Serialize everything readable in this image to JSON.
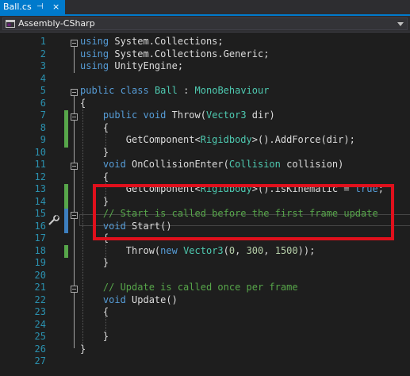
{
  "tab": {
    "title": "Ball.cs",
    "pin_glyph": "⊣",
    "close_glyph": "×"
  },
  "nav": {
    "project": "Assembly-CSharp"
  },
  "colors": {
    "keyword": "#569cd6",
    "type": "#4ec9b0",
    "comment": "#57a64a",
    "number": "#b5cea8",
    "line_number": "#2b91af",
    "highlight_box": "#e0101c",
    "accent": "#007acc"
  },
  "lines": [
    {
      "n": "1",
      "parts": [
        {
          "t": "using",
          "c": "kw"
        },
        {
          "t": " System.Collections;"
        }
      ]
    },
    {
      "n": "2",
      "parts": [
        {
          "t": "using",
          "c": "kw"
        },
        {
          "t": " System.Collections.Generic;"
        }
      ]
    },
    {
      "n": "3",
      "parts": [
        {
          "t": "using",
          "c": "kw"
        },
        {
          "t": " UnityEngine;"
        }
      ]
    },
    {
      "n": "4",
      "parts": []
    },
    {
      "n": "5",
      "parts": [
        {
          "t": "public",
          "c": "kw"
        },
        {
          "t": " "
        },
        {
          "t": "class",
          "c": "kw"
        },
        {
          "t": " "
        },
        {
          "t": "Ball",
          "c": "ty"
        },
        {
          "t": " : "
        },
        {
          "t": "MonoBehaviour",
          "c": "ty"
        }
      ]
    },
    {
      "n": "6",
      "parts": [
        {
          "t": "{"
        }
      ]
    },
    {
      "n": "7",
      "parts": [
        {
          "t": "    "
        },
        {
          "t": "public",
          "c": "kw"
        },
        {
          "t": " "
        },
        {
          "t": "void",
          "c": "kw"
        },
        {
          "t": " Throw("
        },
        {
          "t": "Vector3",
          "c": "ty"
        },
        {
          "t": " dir)"
        }
      ]
    },
    {
      "n": "8",
      "parts": [
        {
          "t": "    {"
        }
      ]
    },
    {
      "n": "9",
      "parts": [
        {
          "t": "        GetComponent<"
        },
        {
          "t": "Rigidbody",
          "c": "ty"
        },
        {
          "t": ">().AddForce(dir);"
        }
      ]
    },
    {
      "n": "10",
      "parts": [
        {
          "t": "    }"
        }
      ]
    },
    {
      "n": "11",
      "parts": [
        {
          "t": "    "
        },
        {
          "t": "void",
          "c": "kw"
        },
        {
          "t": " OnCollisionEnter("
        },
        {
          "t": "Collision",
          "c": "ty"
        },
        {
          "t": " collision)"
        }
      ]
    },
    {
      "n": "12",
      "parts": [
        {
          "t": "    {"
        }
      ]
    },
    {
      "n": "13",
      "parts": [
        {
          "t": "        GetComponent<"
        },
        {
          "t": "Rigidbody",
          "c": "ty"
        },
        {
          "t": ">().isKinematic = "
        },
        {
          "t": "true",
          "c": "kw"
        },
        {
          "t": ";"
        }
      ]
    },
    {
      "n": "14",
      "parts": [
        {
          "t": "    }"
        }
      ]
    },
    {
      "n": "15",
      "parts": [
        {
          "t": "    "
        },
        {
          "t": "// Start is called before the first frame update",
          "c": "cm"
        }
      ]
    },
    {
      "n": "16",
      "parts": [
        {
          "t": "    "
        },
        {
          "t": "void",
          "c": "kw"
        },
        {
          "t": " Start()"
        }
      ]
    },
    {
      "n": "17",
      "parts": [
        {
          "t": "    {"
        }
      ]
    },
    {
      "n": "18",
      "parts": [
        {
          "t": "        Throw("
        },
        {
          "t": "new",
          "c": "kw"
        },
        {
          "t": " "
        },
        {
          "t": "Vector3",
          "c": "ty"
        },
        {
          "t": "("
        },
        {
          "t": "0",
          "c": "nb"
        },
        {
          "t": ", "
        },
        {
          "t": "300",
          "c": "nb"
        },
        {
          "t": ", "
        },
        {
          "t": "1500",
          "c": "nb"
        },
        {
          "t": "));"
        }
      ]
    },
    {
      "n": "19",
      "parts": [
        {
          "t": "    }"
        }
      ]
    },
    {
      "n": "20",
      "parts": []
    },
    {
      "n": "21",
      "parts": [
        {
          "t": "    "
        },
        {
          "t": "// Update is called once per frame",
          "c": "cm"
        }
      ]
    },
    {
      "n": "22",
      "parts": [
        {
          "t": "    "
        },
        {
          "t": "void",
          "c": "kw"
        },
        {
          "t": " Update()"
        }
      ]
    },
    {
      "n": "23",
      "parts": [
        {
          "t": "    {"
        }
      ]
    },
    {
      "n": "24",
      "parts": []
    },
    {
      "n": "25",
      "parts": [
        {
          "t": "    }"
        }
      ]
    },
    {
      "n": "26",
      "parts": [
        {
          "t": "}"
        }
      ]
    },
    {
      "n": "27",
      "parts": []
    }
  ],
  "icons": {
    "project": "csharp-project-icon",
    "quick_action": "wrench-icon",
    "dropdown": "chevron-down-icon"
  }
}
